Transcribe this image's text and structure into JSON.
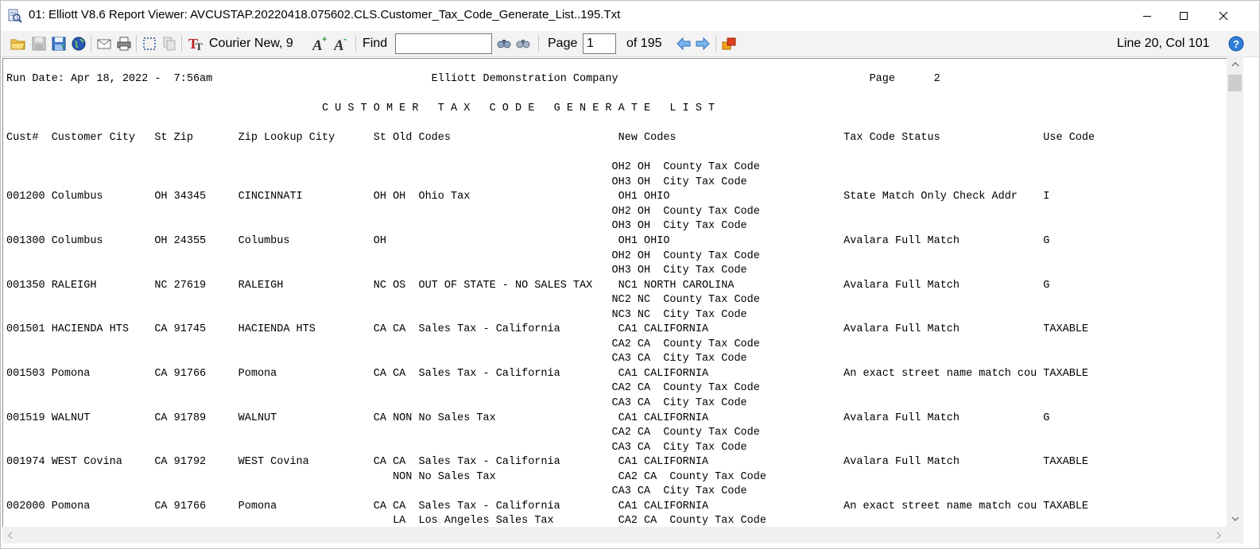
{
  "window": {
    "title": "01: Elliott V8.6 Report Viewer: AVCUSTAP.20220418.075602.CLS.Customer_Tax_Code_Generate_List..195.Txt"
  },
  "toolbar": {
    "font": "Courier New, 9",
    "find_label": "Find",
    "find_value": "",
    "page_label": "Page",
    "page_value": "1",
    "of_pages": "of 195",
    "status": "Line 20, Col 101"
  },
  "report": {
    "lines": [
      "Run Date: Apr 18, 2022 -  7:56am                                  Elliott Demonstration Company                                       Page      2",
      "",
      "                                                 C U S T O M E R   T A X   C O D E   G E N E R A T E   L I S T",
      "",
      "Cust#  Customer City   St Zip       Zip Lookup City      St Old Codes                          New Codes                          Tax Code Status                Use Code",
      "",
      "                                                                                              OH2 OH  County Tax Code",
      "                                                                                              OH3 OH  City Tax Code",
      "001200 Columbus        OH 34345     CINCINNATI           OH OH  Ohio Tax                       OH1 OHIO                           State Match Only Check Addr    I",
      "                                                                                              OH2 OH  County Tax Code",
      "                                                                                              OH3 OH  City Tax Code",
      "001300 Columbus        OH 24355     Columbus             OH                                    OH1 OHIO                           Avalara Full Match             G",
      "                                                                                              OH2 OH  County Tax Code",
      "                                                                                              OH3 OH  City Tax Code",
      "001350 RALEIGH         NC 27619     RALEIGH              NC OS  OUT OF STATE - NO SALES TAX    NC1 NORTH CAROLINA                 Avalara Full Match             G",
      "                                                                                              NC2 NC  County Tax Code",
      "                                                                                              NC3 NC  City Tax Code",
      "001501 HACIENDA HTS    CA 91745     HACIENDA HTS         CA CA  Sales Tax - California         CA1 CALIFORNIA                     Avalara Full Match             TAXABLE",
      "                                                                                              CA2 CA  County Tax Code",
      "                                                                                              CA3 CA  City Tax Code",
      "001503 Pomona          CA 91766     Pomona               CA CA  Sales Tax - California         CA1 CALIFORNIA                     An exact street name match cou TAXABLE",
      "                                                                                              CA2 CA  County Tax Code",
      "                                                                                              CA3 CA  City Tax Code",
      "001519 WALNUT          CA 91789     WALNUT               CA NON No Sales Tax                   CA1 CALIFORNIA                     Avalara Full Match             G",
      "                                                                                              CA2 CA  County Tax Code",
      "                                                                                              CA3 CA  City Tax Code",
      "001974 WEST Covina     CA 91792     WEST Covina          CA CA  Sales Tax - California         CA1 CALIFORNIA                     Avalara Full Match             TAXABLE",
      "                                                            NON No Sales Tax                   CA2 CA  County Tax Code",
      "                                                                                              CA3 CA  City Tax Code",
      "002000 Pomona          CA 91766     Pomona               CA CA  Sales Tax - California         CA1 CALIFORNIA                     An exact street name match cou TAXABLE",
      "                                                            LA  Los Angeles Sales Tax          CA2 CA  County Tax Code"
    ]
  }
}
